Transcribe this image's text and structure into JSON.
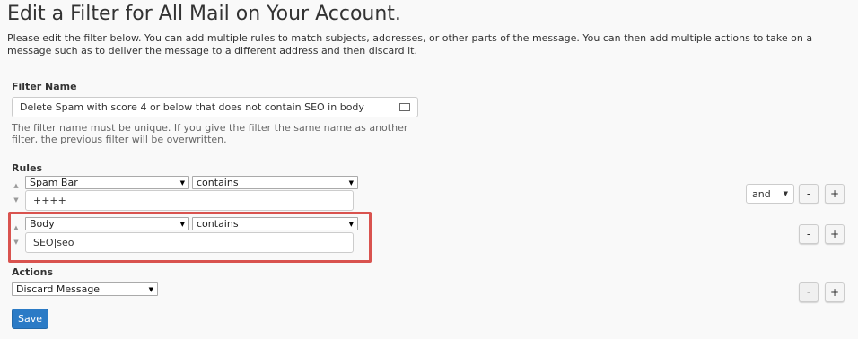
{
  "page": {
    "title": "Edit a Filter for All Mail on Your Account.",
    "description": "Please edit the filter below. You can add multiple rules to match subjects, addresses, or other parts of the message. You can then add multiple actions to take on a message such as to deliver the message to a different address and then discard it."
  },
  "filter_name": {
    "label": "Filter Name",
    "value": "Delete Spam with score 4 or below that does not contain SEO in body",
    "help": "The filter name must be unique. If you give the filter the same name as another filter, the previous filter will be overwritten."
  },
  "rules": {
    "label": "Rules",
    "items": [
      {
        "part": "Spam Bar",
        "match": "contains",
        "value": "++++",
        "connector": "and"
      },
      {
        "part": "Body",
        "match": "contains",
        "value": "SEO|seo"
      }
    ],
    "minus": "-",
    "plus": "+"
  },
  "actions": {
    "label": "Actions",
    "selected": "Discard Message",
    "minus": "-",
    "plus": "+"
  },
  "save_label": "Save",
  "colors": {
    "highlight": "#d9534f",
    "primary": "#2b7bc6"
  }
}
